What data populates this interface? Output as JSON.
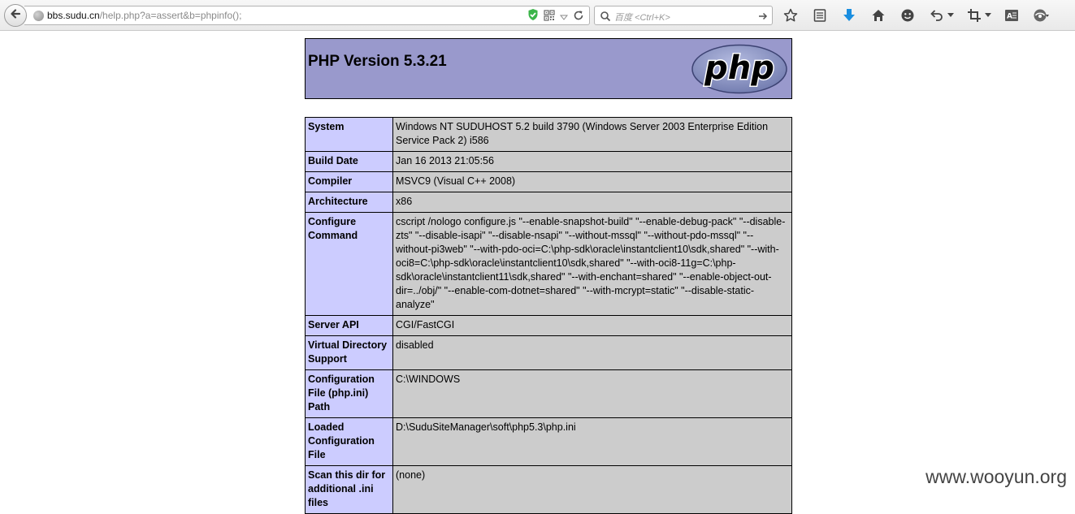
{
  "browser": {
    "url": {
      "host": "bbs.sudu.cn",
      "path": "/help.php?a=assert&b=phpinfo();"
    },
    "search": {
      "placeholder": "百度 <Ctrl+K>"
    },
    "icons": [
      "back-icon",
      "globe-icon",
      "shield-check-icon",
      "qr-code-icon",
      "dropdown-icon",
      "reload-icon",
      "search-icon",
      "go-arrow-icon",
      "bookmark-star-icon",
      "reading-list-icon",
      "download-icon",
      "home-icon",
      "emoji-icon",
      "undo-icon",
      "crop-icon",
      "reader-mode-icon",
      "addon-menu-icon"
    ]
  },
  "page": {
    "title": "PHP Version 5.3.21",
    "logo_text": "php",
    "rows": [
      {
        "key": "System",
        "value": "Windows NT SUDUHOST 5.2 build 3790 (Windows Server 2003 Enterprise Edition Service Pack 2) i586"
      },
      {
        "key": "Build Date",
        "value": "Jan 16 2013 21:05:56"
      },
      {
        "key": "Compiler",
        "value": "MSVC9 (Visual C++ 2008)"
      },
      {
        "key": "Architecture",
        "value": "x86"
      },
      {
        "key": "Configure Command",
        "value": "cscript /nologo configure.js \"--enable-snapshot-build\" \"--enable-debug-pack\" \"--disable-zts\" \"--disable-isapi\" \"--disable-nsapi\" \"--without-mssql\" \"--without-pdo-mssql\" \"--without-pi3web\" \"--with-pdo-oci=C:\\php-sdk\\oracle\\instantclient10\\sdk,shared\" \"--with-oci8=C:\\php-sdk\\oracle\\instantclient10\\sdk,shared\" \"--with-oci8-11g=C:\\php-sdk\\oracle\\instantclient11\\sdk,shared\" \"--with-enchant=shared\" \"--enable-object-out-dir=../obj/\" \"--enable-com-dotnet=shared\" \"--with-mcrypt=static\" \"--disable-static-analyze\""
      },
      {
        "key": "Server API",
        "value": "CGI/FastCGI"
      },
      {
        "key": "Virtual Directory Support",
        "value": "disabled"
      },
      {
        "key": "Configuration File (php.ini) Path",
        "value": "C:\\WINDOWS"
      },
      {
        "key": "Loaded Configuration File",
        "value": "D:\\SuduSiteManager\\soft\\php5.3\\php.ini"
      },
      {
        "key": "Scan this dir for additional .ini files",
        "value": "(none)"
      }
    ]
  },
  "watermark": "www.wooyun.org",
  "colors": {
    "header_bg": "#9999cc",
    "key_bg": "#ccccff",
    "value_bg": "#cccccc",
    "logo_fill": "#8892bf"
  }
}
